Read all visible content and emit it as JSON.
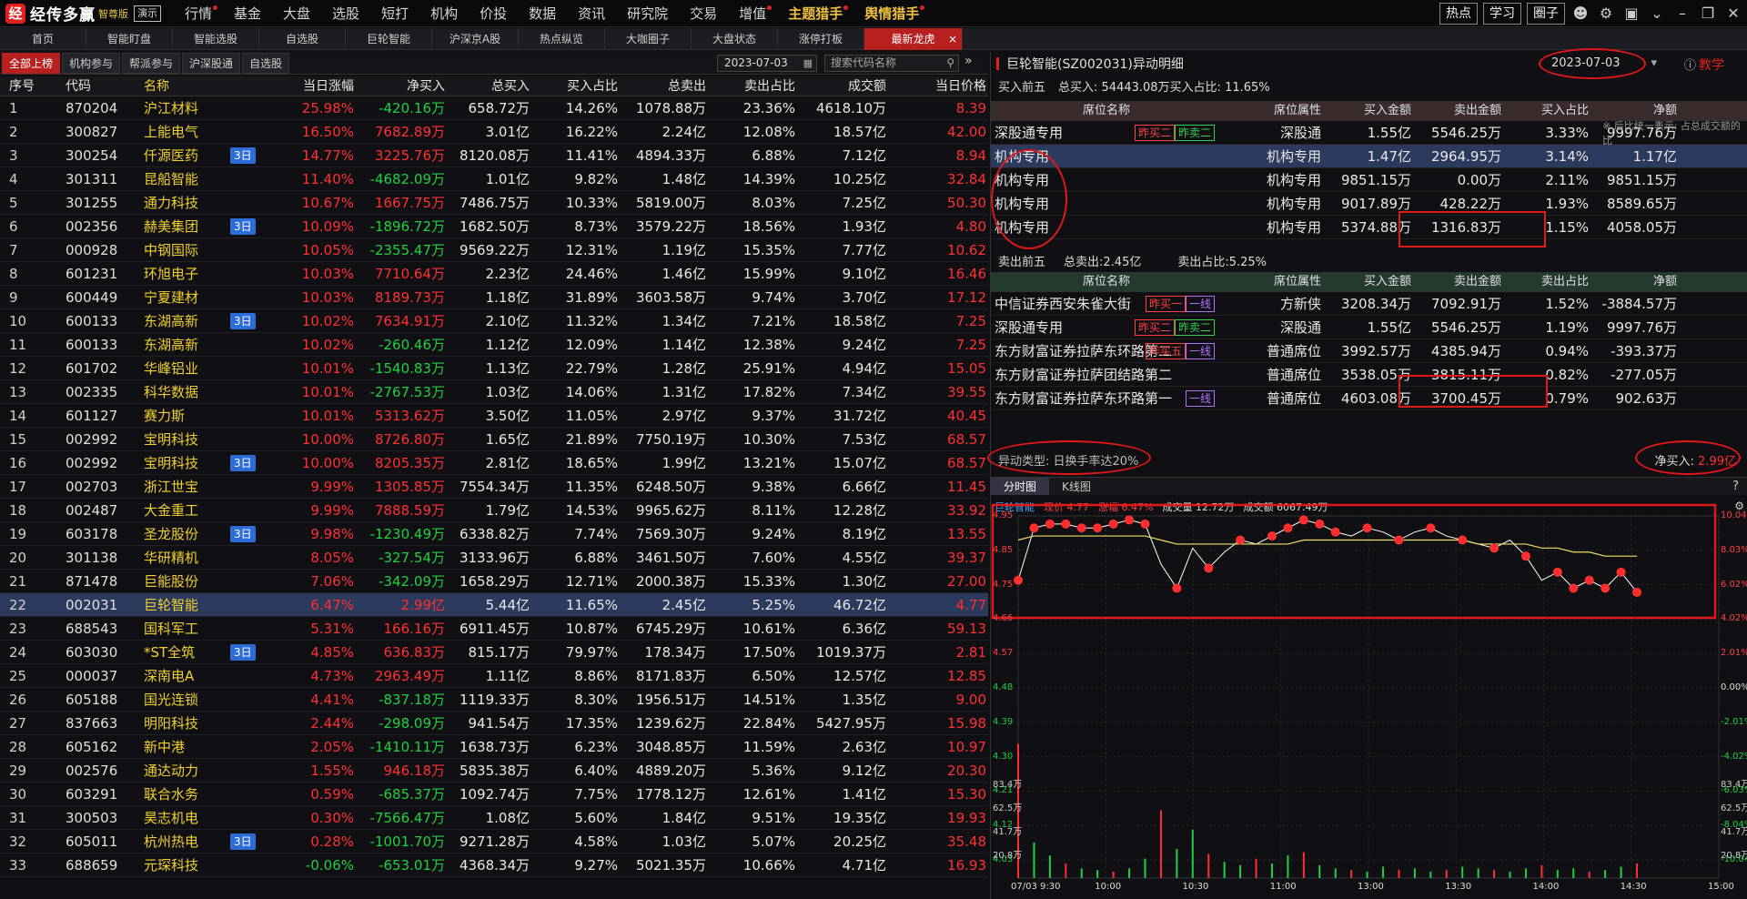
{
  "app": {
    "logo_mark": "经",
    "name": "经传多赢",
    "edition": "智尊版",
    "demo": "演示"
  },
  "topnav": [
    {
      "label": "行情",
      "dot": true
    },
    {
      "label": "基金",
      "dot": false
    },
    {
      "label": "大盘",
      "dot": false
    },
    {
      "label": "选股",
      "dot": false
    },
    {
      "label": "短打",
      "dot": false
    },
    {
      "label": "机构",
      "dot": false
    },
    {
      "label": "价投",
      "dot": false
    },
    {
      "label": "数据",
      "dot": false
    },
    {
      "label": "资讯",
      "dot": false
    },
    {
      "label": "研究院",
      "dot": false
    },
    {
      "label": "交易",
      "dot": false
    },
    {
      "label": "增值",
      "dot": true
    },
    {
      "label": "主题猎手",
      "dot": true,
      "highlight": true
    },
    {
      "label": "舆情猎手",
      "dot": true,
      "highlight": true
    }
  ],
  "topright": {
    "hot": "热点",
    "study": "学习",
    "circle": "圈子"
  },
  "tabs": [
    "首页",
    "智能盯盘",
    "智能选股",
    "自选股",
    "巨轮智能",
    "沪深京A股",
    "热点纵览",
    "大咖圈子",
    "大盘状态",
    "涨停打板",
    "最新龙虎"
  ],
  "active_tab_close": "×",
  "subtabs": [
    "全部上榜",
    "机构参与",
    "帮派参与",
    "沪深股通",
    "自选股"
  ],
  "filter": {
    "date": "2023-07-03",
    "search_placeholder": "搜索代码名称"
  },
  "table": {
    "headers": [
      "序号",
      "代码",
      "名称",
      "当日涨幅",
      "净买入",
      "总买入",
      "买入占比",
      "总卖出",
      "卖出占比",
      "成交额",
      "当日价格"
    ],
    "rows": [
      {
        "n": "1",
        "code": "870204",
        "name": "沪江材料",
        "tag": "",
        "chg": "25.98%",
        "net": "-420.16万",
        "buy": "658.72万",
        "bp": "14.26%",
        "sell": "1078.88万",
        "sp": "23.36%",
        "amt": "4618.10万",
        "price": "8.39"
      },
      {
        "n": "2",
        "code": "300827",
        "name": "上能电气",
        "tag": "",
        "chg": "16.50%",
        "net": "7682.89万",
        "buy": "3.01亿",
        "bp": "16.22%",
        "sell": "2.24亿",
        "sp": "12.08%",
        "amt": "18.57亿",
        "price": "42.00"
      },
      {
        "n": "3",
        "code": "300254",
        "name": "仟源医药",
        "tag": "3日",
        "chg": "14.77%",
        "net": "3225.76万",
        "buy": "8120.08万",
        "bp": "11.41%",
        "sell": "4894.33万",
        "sp": "6.88%",
        "amt": "7.12亿",
        "price": "8.94"
      },
      {
        "n": "4",
        "code": "301311",
        "name": "昆船智能",
        "tag": "",
        "chg": "11.40%",
        "net": "-4682.09万",
        "buy": "1.01亿",
        "bp": "9.82%",
        "sell": "1.48亿",
        "sp": "14.39%",
        "amt": "10.25亿",
        "price": "32.84"
      },
      {
        "n": "5",
        "code": "301255",
        "name": "通力科技",
        "tag": "",
        "chg": "10.67%",
        "net": "1667.75万",
        "buy": "7486.75万",
        "bp": "10.33%",
        "sell": "5819.00万",
        "sp": "8.03%",
        "amt": "7.25亿",
        "price": "50.30"
      },
      {
        "n": "6",
        "code": "002356",
        "name": "赫美集团",
        "tag": "3日",
        "chg": "10.09%",
        "net": "-1896.72万",
        "buy": "1682.50万",
        "bp": "8.73%",
        "sell": "3579.22万",
        "sp": "18.56%",
        "amt": "1.93亿",
        "price": "4.80"
      },
      {
        "n": "7",
        "code": "000928",
        "name": "中钢国际",
        "tag": "",
        "chg": "10.05%",
        "net": "-2355.47万",
        "buy": "9569.22万",
        "bp": "12.31%",
        "sell": "1.19亿",
        "sp": "15.35%",
        "amt": "7.77亿",
        "price": "10.62"
      },
      {
        "n": "8",
        "code": "601231",
        "name": "环旭电子",
        "tag": "",
        "chg": "10.03%",
        "net": "7710.64万",
        "buy": "2.23亿",
        "bp": "24.46%",
        "sell": "1.46亿",
        "sp": "15.99%",
        "amt": "9.10亿",
        "price": "16.46"
      },
      {
        "n": "9",
        "code": "600449",
        "name": "宁夏建材",
        "tag": "",
        "chg": "10.03%",
        "net": "8189.73万",
        "buy": "1.18亿",
        "bp": "31.89%",
        "sell": "3603.58万",
        "sp": "9.74%",
        "amt": "3.70亿",
        "price": "17.12"
      },
      {
        "n": "10",
        "code": "600133",
        "name": "东湖高新",
        "tag": "3日",
        "chg": "10.02%",
        "net": "7634.91万",
        "buy": "2.10亿",
        "bp": "11.32%",
        "sell": "1.34亿",
        "sp": "7.21%",
        "amt": "18.58亿",
        "price": "7.25"
      },
      {
        "n": "11",
        "code": "600133",
        "name": "东湖高新",
        "tag": "",
        "chg": "10.02%",
        "net": "-260.46万",
        "buy": "1.12亿",
        "bp": "12.09%",
        "sell": "1.14亿",
        "sp": "12.38%",
        "amt": "9.24亿",
        "price": "7.25"
      },
      {
        "n": "12",
        "code": "601702",
        "name": "华峰铝业",
        "tag": "",
        "chg": "10.01%",
        "net": "-1540.83万",
        "buy": "1.13亿",
        "bp": "22.79%",
        "sell": "1.28亿",
        "sp": "25.91%",
        "amt": "4.94亿",
        "price": "15.05"
      },
      {
        "n": "13",
        "code": "002335",
        "name": "科华数据",
        "tag": "",
        "chg": "10.01%",
        "net": "-2767.53万",
        "buy": "1.03亿",
        "bp": "14.06%",
        "sell": "1.31亿",
        "sp": "17.82%",
        "amt": "7.34亿",
        "price": "39.55"
      },
      {
        "n": "14",
        "code": "601127",
        "name": "赛力斯",
        "tag": "",
        "chg": "10.01%",
        "net": "5313.62万",
        "buy": "3.50亿",
        "bp": "11.05%",
        "sell": "2.97亿",
        "sp": "9.37%",
        "amt": "31.72亿",
        "price": "40.45"
      },
      {
        "n": "15",
        "code": "002992",
        "name": "宝明科技",
        "tag": "",
        "chg": "10.00%",
        "net": "8726.80万",
        "buy": "1.65亿",
        "bp": "21.89%",
        "sell": "7750.19万",
        "sp": "10.30%",
        "amt": "7.53亿",
        "price": "68.57"
      },
      {
        "n": "16",
        "code": "002992",
        "name": "宝明科技",
        "tag": "3日",
        "chg": "10.00%",
        "net": "8205.35万",
        "buy": "2.81亿",
        "bp": "18.65%",
        "sell": "1.99亿",
        "sp": "13.21%",
        "amt": "15.07亿",
        "price": "68.57"
      },
      {
        "n": "17",
        "code": "002703",
        "name": "浙江世宝",
        "tag": "",
        "chg": "9.99%",
        "net": "1305.85万",
        "buy": "7554.34万",
        "bp": "11.35%",
        "sell": "6248.50万",
        "sp": "9.38%",
        "amt": "6.66亿",
        "price": "11.45"
      },
      {
        "n": "18",
        "code": "002487",
        "name": "大金重工",
        "tag": "",
        "chg": "9.99%",
        "net": "7888.59万",
        "buy": "1.79亿",
        "bp": "14.53%",
        "sell": "9965.62万",
        "sp": "8.11%",
        "amt": "12.28亿",
        "price": "33.92"
      },
      {
        "n": "19",
        "code": "603178",
        "name": "圣龙股份",
        "tag": "3日",
        "chg": "9.98%",
        "net": "-1230.49万",
        "buy": "6338.82万",
        "bp": "7.74%",
        "sell": "7569.30万",
        "sp": "9.24%",
        "amt": "8.19亿",
        "price": "13.55"
      },
      {
        "n": "20",
        "code": "301138",
        "name": "华研精机",
        "tag": "",
        "chg": "8.05%",
        "net": "-327.54万",
        "buy": "3133.96万",
        "bp": "6.88%",
        "sell": "3461.50万",
        "sp": "7.60%",
        "amt": "4.55亿",
        "price": "39.37"
      },
      {
        "n": "21",
        "code": "871478",
        "name": "巨能股份",
        "tag": "",
        "chg": "7.06%",
        "net": "-342.09万",
        "buy": "1658.29万",
        "bp": "12.71%",
        "sell": "2000.38万",
        "sp": "15.33%",
        "amt": "1.30亿",
        "price": "27.00"
      },
      {
        "n": "22",
        "code": "002031",
        "name": "巨轮智能",
        "tag": "",
        "chg": "6.47%",
        "net": "2.99亿",
        "buy": "5.44亿",
        "bp": "11.65%",
        "sell": "2.45亿",
        "sp": "5.25%",
        "amt": "46.72亿",
        "price": "4.77",
        "selected": true
      },
      {
        "n": "23",
        "code": "688543",
        "name": "国科军工",
        "tag": "",
        "chg": "5.31%",
        "net": "166.16万",
        "buy": "6911.45万",
        "bp": "10.87%",
        "sell": "6745.29万",
        "sp": "10.61%",
        "amt": "6.36亿",
        "price": "59.13"
      },
      {
        "n": "24",
        "code": "603030",
        "name": "*ST全筑",
        "tag": "3日",
        "chg": "4.85%",
        "net": "636.83万",
        "buy": "815.17万",
        "bp": "79.97%",
        "sell": "178.34万",
        "sp": "17.50%",
        "amt": "1019.37万",
        "price": "2.81"
      },
      {
        "n": "25",
        "code": "000037",
        "name": "深南电A",
        "tag": "",
        "chg": "4.73%",
        "net": "2963.49万",
        "buy": "1.11亿",
        "bp": "8.86%",
        "sell": "8171.83万",
        "sp": "6.50%",
        "amt": "12.57亿",
        "price": "12.85"
      },
      {
        "n": "26",
        "code": "605188",
        "name": "国光连锁",
        "tag": "",
        "chg": "4.41%",
        "net": "-837.18万",
        "buy": "1119.33万",
        "bp": "8.30%",
        "sell": "1956.51万",
        "sp": "14.51%",
        "amt": "1.35亿",
        "price": "9.00"
      },
      {
        "n": "27",
        "code": "837663",
        "name": "明阳科技",
        "tag": "",
        "chg": "2.44%",
        "net": "-298.09万",
        "buy": "941.54万",
        "bp": "17.35%",
        "sell": "1239.62万",
        "sp": "22.84%",
        "amt": "5427.95万",
        "price": "15.98"
      },
      {
        "n": "28",
        "code": "605162",
        "name": "新中港",
        "tag": "",
        "chg": "2.05%",
        "net": "-1410.11万",
        "buy": "1638.73万",
        "bp": "6.23%",
        "sell": "3048.85万",
        "sp": "11.59%",
        "amt": "2.63亿",
        "price": "10.97"
      },
      {
        "n": "29",
        "code": "002576",
        "name": "通达动力",
        "tag": "",
        "chg": "1.55%",
        "net": "946.18万",
        "buy": "5835.38万",
        "bp": "6.40%",
        "sell": "4889.20万",
        "sp": "5.36%",
        "amt": "9.12亿",
        "price": "20.30"
      },
      {
        "n": "30",
        "code": "603291",
        "name": "联合水务",
        "tag": "",
        "chg": "0.59%",
        "net": "-685.37万",
        "buy": "1092.74万",
        "bp": "7.75%",
        "sell": "1778.12万",
        "sp": "12.61%",
        "amt": "1.41亿",
        "price": "15.30"
      },
      {
        "n": "31",
        "code": "300503",
        "name": "昊志机电",
        "tag": "",
        "chg": "0.30%",
        "net": "-7566.47万",
        "buy": "1.08亿",
        "bp": "5.60%",
        "sell": "1.84亿",
        "sp": "9.51%",
        "amt": "19.35亿",
        "price": "19.93"
      },
      {
        "n": "32",
        "code": "605011",
        "name": "杭州热电",
        "tag": "3日",
        "chg": "0.28%",
        "net": "-1001.70万",
        "buy": "9271.28万",
        "bp": "4.58%",
        "sell": "1.03亿",
        "sp": "5.07%",
        "amt": "20.25亿",
        "price": "35.48"
      },
      {
        "n": "33",
        "code": "688659",
        "name": "元琛科技",
        "tag": "",
        "chg": "-0.06%",
        "net": "-653.01万",
        "buy": "4368.34万",
        "bp": "9.27%",
        "sell": "5021.35万",
        "sp": "10.66%",
        "amt": "4.71亿",
        "price": "16.93"
      }
    ]
  },
  "detail": {
    "title": "巨轮智能(SZ002031)异动明细",
    "date": "2023-07-03",
    "teach": "教学",
    "buy_top_label": "买入前五",
    "buy_total": "总买入: 54443.08万买入占比: 11.65%",
    "note": "※ 后比统一表示: 占总成交额的比",
    "headers": [
      "席位名称",
      "席位属性",
      "买入金额",
      "卖出金额",
      "买入占比",
      "净额"
    ],
    "sell_headers": [
      "席位名称",
      "席位属性",
      "买入金额",
      "卖出金额",
      "卖出占比",
      "净额"
    ],
    "buy_rows": [
      {
        "name": "深股通专用",
        "badges": [
          {
            "t": "昨买二",
            "c": "red"
          },
          {
            "t": "昨卖二",
            "c": "green"
          }
        ],
        "attr": "深股通",
        "buy": "1.55亿",
        "sell": "5546.25万",
        "pct": "3.33%",
        "net": "9997.76万"
      },
      {
        "name": "机构专用",
        "badges": [],
        "attr": "机构专用",
        "buy": "1.47亿",
        "sell": "2964.95万",
        "pct": "3.14%",
        "net": "1.17亿",
        "selected": true
      },
      {
        "name": "机构专用",
        "badges": [],
        "attr": "机构专用",
        "buy": "9851.15万",
        "sell": "0.00万",
        "pct": "2.11%",
        "net": "9851.15万"
      },
      {
        "name": "机构专用",
        "badges": [],
        "attr": "机构专用",
        "buy": "9017.89万",
        "sell": "428.22万",
        "pct": "1.93%",
        "net": "8589.65万"
      },
      {
        "name": "机构专用",
        "badges": [],
        "attr": "机构专用",
        "buy": "5374.88万",
        "sell": "1316.83万",
        "pct": "1.15%",
        "net": "4058.05万"
      }
    ],
    "sell_top_label": "卖出前五",
    "sell_total": "总卖出:2.45亿",
    "sell_pct": "卖出占比:5.25%",
    "sell_rows": [
      {
        "name": "中信证券西安朱雀大街",
        "badges": [
          {
            "t": "昨买一",
            "c": "red"
          },
          {
            "t": "一线",
            "c": "purple"
          }
        ],
        "attr": "方新侠",
        "buy": "3208.34万",
        "sell": "7092.91万",
        "pct": "1.52%",
        "net": "-3884.57万"
      },
      {
        "name": "深股通专用",
        "badges": [
          {
            "t": "昨买二",
            "c": "red"
          },
          {
            "t": "昨卖二",
            "c": "green"
          }
        ],
        "attr": "深股通",
        "buy": "1.55亿",
        "sell": "5546.25万",
        "pct": "1.19%",
        "net": "9997.76万"
      },
      {
        "name": "东方财富证券拉萨东环路第二",
        "badges": [
          {
            "t": "昨买五",
            "c": "red"
          },
          {
            "t": "一线",
            "c": "purple"
          }
        ],
        "attr": "普通席位",
        "buy": "3992.57万",
        "sell": "4385.94万",
        "pct": "0.94%",
        "net": "-393.37万"
      },
      {
        "name": "东方财富证券拉萨团结路第二",
        "badges": [],
        "attr": "普通席位",
        "buy": "3538.05万",
        "sell": "3815.11万",
        "pct": "0.82%",
        "net": "-277.05万"
      },
      {
        "name": "东方财富证券拉萨东环路第一",
        "badges": [
          {
            "t": "一线",
            "c": "purple"
          }
        ],
        "attr": "普通席位",
        "buy": "4603.08万",
        "sell": "3700.45万",
        "pct": "0.79%",
        "net": "902.63万"
      }
    ],
    "abnormal": "异动类型: 日换手率达20%",
    "net_label": "净买入:",
    "net_value": "2.99亿"
  },
  "chart_tabs": [
    "分时图",
    "K线图"
  ],
  "chart_data": {
    "type": "line",
    "title": "巨轮智能",
    "price_label": "现价 4.77",
    "chg_label": "涨幅 6.47%",
    "vol_label": "成交量 12.72万",
    "amt_label": "成交额 6067.49万",
    "x": [
      "09:30",
      "10:00",
      "10:30",
      "11:00",
      "13:00",
      "13:30",
      "14:00",
      "14:30",
      "15:00"
    ],
    "x_labels": [
      "07/03 9:30",
      "10:00",
      "10:30",
      "11:00",
      "13:00",
      "13:30",
      "14:00",
      "14:30",
      "15:00"
    ],
    "y_left": [
      "4.95",
      "4.85",
      "4.75",
      "4.66",
      "4.57",
      "4.48",
      "4.39",
      "4.30",
      "4.21",
      "4.12",
      "4.03"
    ],
    "y_right": [
      "10.04%",
      "8.03%",
      "6.02%",
      "4.02%",
      "2.01%",
      "0.00%",
      "-2.01%",
      "-4.02%",
      "-6.03%",
      "-8.04%",
      "-10.04%"
    ],
    "vol_y": [
      "83.4万",
      "62.5万",
      "41.7万",
      "20.8万"
    ],
    "ylim": [
      4.03,
      4.95
    ],
    "price_series": [
      4.8,
      4.93,
      4.94,
      4.94,
      4.93,
      4.93,
      4.94,
      4.95,
      4.94,
      4.84,
      4.78,
      4.88,
      4.83,
      4.87,
      4.9,
      4.89,
      4.91,
      4.93,
      4.95,
      4.94,
      4.92,
      4.91,
      4.93,
      4.92,
      4.9,
      4.92,
      4.93,
      4.91,
      4.9,
      4.89,
      4.88,
      4.9,
      4.86,
      4.8,
      4.82,
      4.78,
      4.8,
      4.78,
      4.82,
      4.77
    ],
    "avg_series": [
      4.9,
      4.91,
      4.91,
      4.91,
      4.91,
      4.91,
      4.91,
      4.91,
      4.91,
      4.9,
      4.89,
      4.89,
      4.89,
      4.89,
      4.89,
      4.89,
      4.89,
      4.89,
      4.9,
      4.9,
      4.9,
      4.9,
      4.9,
      4.9,
      4.9,
      4.9,
      4.9,
      4.9,
      4.9,
      4.89,
      4.89,
      4.89,
      4.89,
      4.88,
      4.88,
      4.87,
      4.87,
      4.86,
      4.86,
      4.86
    ],
    "volume": [
      83,
      22,
      14,
      9,
      6,
      5,
      4,
      6,
      12,
      42,
      18,
      30,
      15,
      10,
      8,
      12,
      9,
      14,
      16,
      8,
      6,
      5,
      4,
      7,
      5,
      6,
      4,
      5,
      7,
      6,
      5,
      4,
      6,
      8,
      5,
      6,
      4,
      5,
      7,
      9
    ]
  }
}
